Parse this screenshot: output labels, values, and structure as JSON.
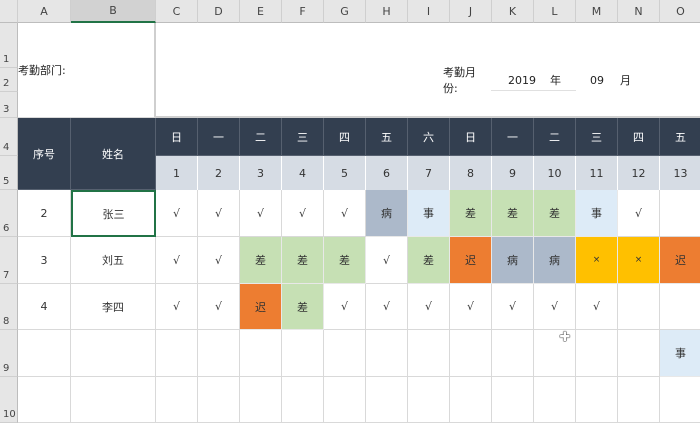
{
  "columns": [
    "A",
    "B",
    "C",
    "D",
    "E",
    "F",
    "G",
    "H",
    "I",
    "J",
    "K",
    "L",
    "M",
    "N",
    "O"
  ],
  "row_numbers": [
    "1",
    "2",
    "3",
    "4",
    "5",
    "6",
    "7",
    "8",
    "9",
    "10"
  ],
  "title_area": {
    "dept_label": "考勤部门:",
    "month_label": "考勤月份:",
    "year": "2019",
    "year_unit": "年",
    "month": "09",
    "month_unit": "月"
  },
  "header": {
    "seq": "序号",
    "name": "姓名",
    "weekdays": [
      "日",
      "一",
      "二",
      "三",
      "四",
      "五",
      "六",
      "日",
      "一",
      "二",
      "三",
      "四",
      "五"
    ],
    "days": [
      "1",
      "2",
      "3",
      "4",
      "5",
      "6",
      "7",
      "8",
      "9",
      "10",
      "11",
      "12",
      "13"
    ]
  },
  "status_colors": {
    "病": "#acb9ca",
    "事": "#ddebf7",
    "差": "#c6e0b4",
    "迟": "#ed7d31",
    "×": "#ffc000"
  },
  "rows": [
    {
      "seq": "2",
      "name": "张三",
      "marks": [
        "√",
        "√",
        "√",
        "√",
        "√",
        "病",
        "事",
        "差",
        "差",
        "差",
        "事",
        "√",
        ""
      ]
    },
    {
      "seq": "3",
      "name": "刘五",
      "marks": [
        "√",
        "√",
        "差",
        "差",
        "差",
        "√",
        "差",
        "迟",
        "病",
        "病",
        "×",
        "×",
        "迟"
      ]
    },
    {
      "seq": "4",
      "name": "李四",
      "marks": [
        "√",
        "√",
        "迟",
        "差",
        "√",
        "√",
        "√",
        "√",
        "√",
        "√",
        "√",
        "",
        ""
      ]
    },
    {
      "seq": "",
      "name": "",
      "marks": [
        "",
        "",
        "",
        "",
        "",
        "",
        "",
        "",
        "",
        "",
        "",
        "",
        "事"
      ]
    },
    {
      "seq": "",
      "name": "",
      "marks": [
        "",
        "",
        "",
        "",
        "",
        "",
        "",
        "",
        "",
        "",
        "",
        "",
        ""
      ]
    }
  ]
}
